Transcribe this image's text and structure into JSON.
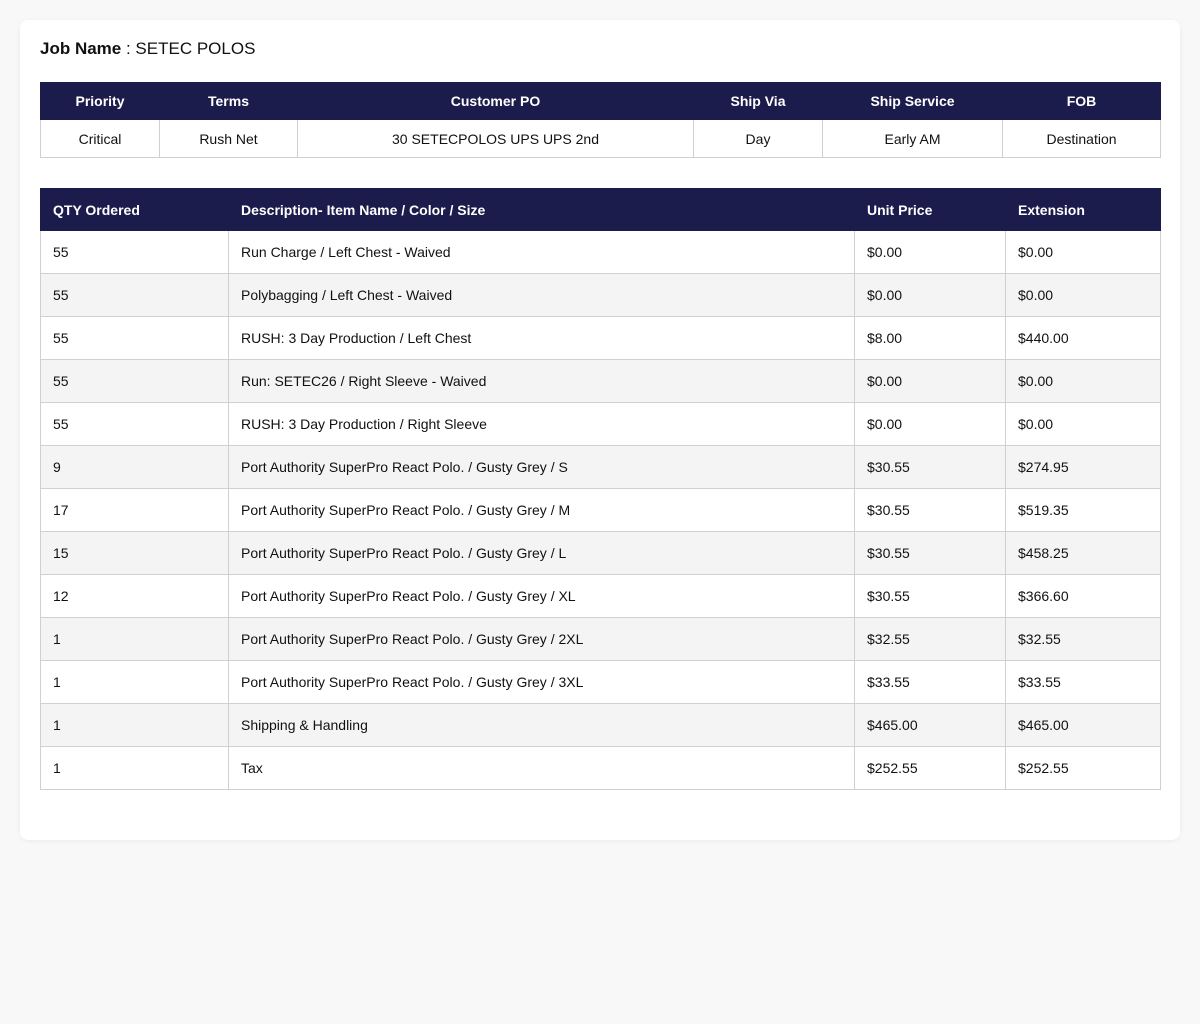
{
  "job": {
    "label": "Job Name",
    "separator": " : ",
    "value": "SETEC POLOS"
  },
  "info": {
    "headers": [
      "Priority",
      "Terms",
      "Customer PO",
      "Ship Via",
      "Ship Service",
      "FOB"
    ],
    "values": [
      "Critical",
      "Rush Net",
      "30 SETECPOLOS UPS UPS 2nd",
      "Day",
      "Early AM",
      "Destination"
    ]
  },
  "items": {
    "headers": [
      "QTY Ordered",
      "Description- Item Name / Color / Size",
      "Unit Price",
      "Extension"
    ],
    "rows": [
      [
        "55",
        "Run Charge / Left Chest - Waived",
        "$0.00",
        "$0.00"
      ],
      [
        "55",
        "Polybagging / Left Chest - Waived",
        "$0.00",
        "$0.00"
      ],
      [
        "55",
        "RUSH: 3 Day Production / Left Chest",
        "$8.00",
        "$440.00"
      ],
      [
        "55",
        "Run: SETEC26 / Right Sleeve - Waived",
        "$0.00",
        "$0.00"
      ],
      [
        "55",
        "RUSH: 3 Day Production / Right Sleeve",
        "$0.00",
        "$0.00"
      ],
      [
        "9",
        "Port Authority SuperPro React Polo. / Gusty Grey / S",
        "$30.55",
        "$274.95"
      ],
      [
        "17",
        "Port Authority SuperPro React Polo. / Gusty Grey / M",
        "$30.55",
        "$519.35"
      ],
      [
        "15",
        "Port Authority SuperPro React Polo. / Gusty Grey / L",
        "$30.55",
        "$458.25"
      ],
      [
        "12",
        "Port Authority SuperPro React Polo. / Gusty Grey / XL",
        "$30.55",
        "$366.60"
      ],
      [
        "1",
        "Port Authority SuperPro React Polo. / Gusty Grey / 2XL",
        "$32.55",
        "$32.55"
      ],
      [
        "1",
        "Port Authority SuperPro React Polo. / Gusty Grey / 3XL",
        "$33.55",
        "$33.55"
      ],
      [
        "1",
        "Shipping & Handling",
        "$465.00",
        "$465.00"
      ],
      [
        "1",
        "Tax",
        "$252.55",
        "$252.55"
      ]
    ]
  },
  "colors": {
    "header_bg": "#1c1c4c",
    "alt_row_bg": "#f4f4f4",
    "page_bg": "#f8f8f8"
  }
}
